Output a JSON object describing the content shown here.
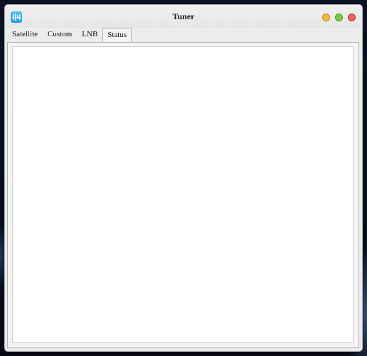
{
  "window": {
    "title": "Tuner",
    "app_icon": "tuner-app-icon"
  },
  "window_controls": [
    "minimize-button",
    "maximize-button",
    "close-button"
  ],
  "colors": {
    "minimize": "#f5b83b",
    "maximize": "#7dc93f",
    "close": "#e8665b",
    "app_icon": "#2aa9ea"
  },
  "tabs": [
    {
      "label": "Satellite",
      "active": false
    },
    {
      "label": "Custom",
      "active": false
    },
    {
      "label": "LNB",
      "active": false
    },
    {
      "label": "Status",
      "active": true
    }
  ]
}
